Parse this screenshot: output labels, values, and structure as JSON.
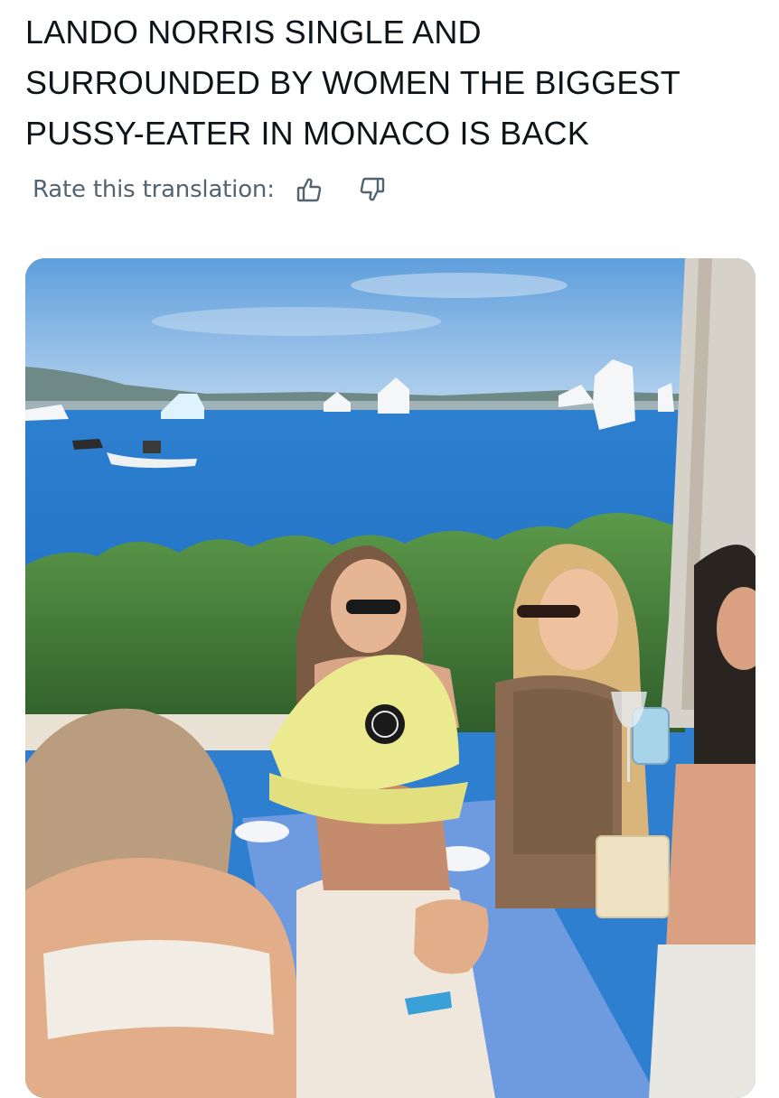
{
  "post": {
    "text_lines": [
      "LANDO NORRIS SINGLE AND",
      "SURROUNDED BY WOMEN THE BIGGEST",
      "PUSSY-EATER IN MONACO IS BACK"
    ]
  },
  "translation": {
    "rate_label": "Rate this translation:",
    "thumbs_up_icon": "thumbs-up-icon",
    "thumbs_down_icon": "thumbs-down-icon"
  },
  "media": {
    "description_icon": "photo",
    "cap_patch_text": "",
    "colors": {
      "sky": "#7fb2e2",
      "sea": "#2f86d4",
      "hedge": "#3e7a35",
      "cap": "#ecea8e",
      "tablecloth": "#6e9be0"
    }
  }
}
